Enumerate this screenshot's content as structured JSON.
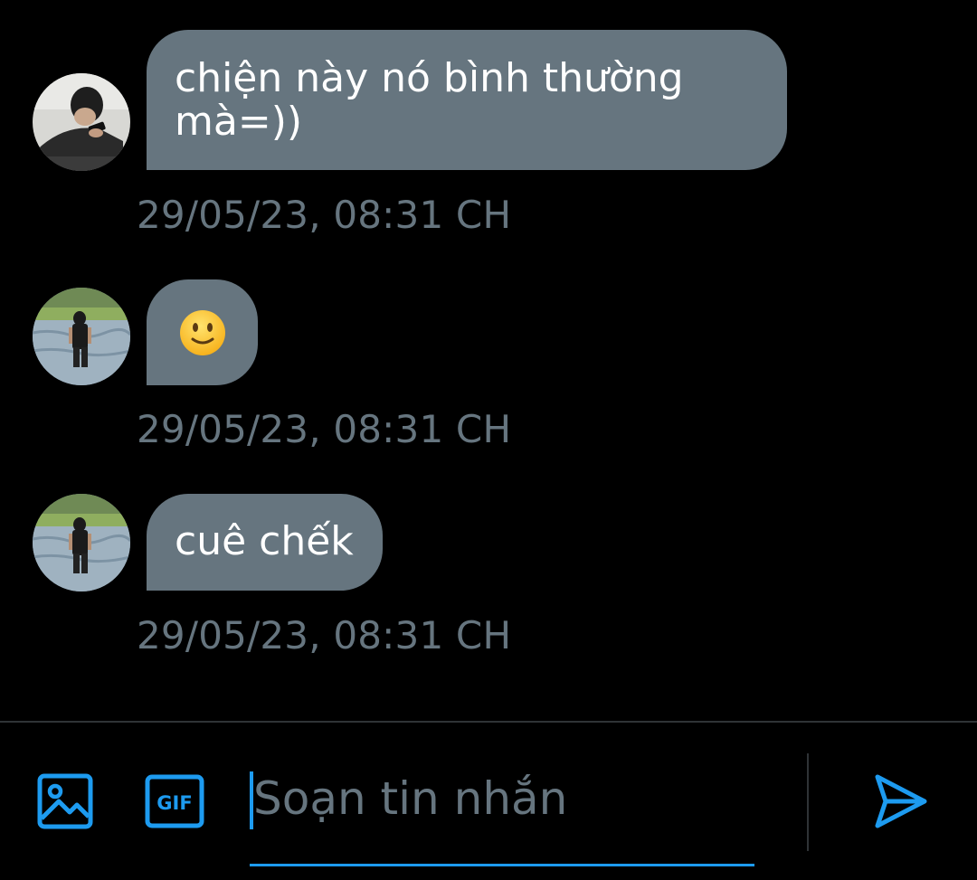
{
  "messages": [
    {
      "text": "chiện này nó bình thường mà=))",
      "timestamp": "29/05/23, 08:31 CH",
      "avatar": "avatar-person-lying-with-phone"
    },
    {
      "text": "🙂",
      "timestamp": "29/05/23, 08:31 CH",
      "avatar": "avatar-person-standing-in-water"
    },
    {
      "text": "cuê chếk",
      "timestamp": "29/05/23, 08:31 CH",
      "avatar": "avatar-person-standing-in-water"
    }
  ],
  "composer": {
    "placeholder": "Soạn tin nhắn",
    "value": "",
    "icons": {
      "image": "image-icon",
      "gif": "gif-icon",
      "send": "send-icon"
    },
    "gif_label": "GIF"
  },
  "colors": {
    "background": "#000000",
    "bubble": "#66757f",
    "timestamp": "#66757f",
    "accent": "#1d9bf0",
    "divider": "#2f3336"
  }
}
